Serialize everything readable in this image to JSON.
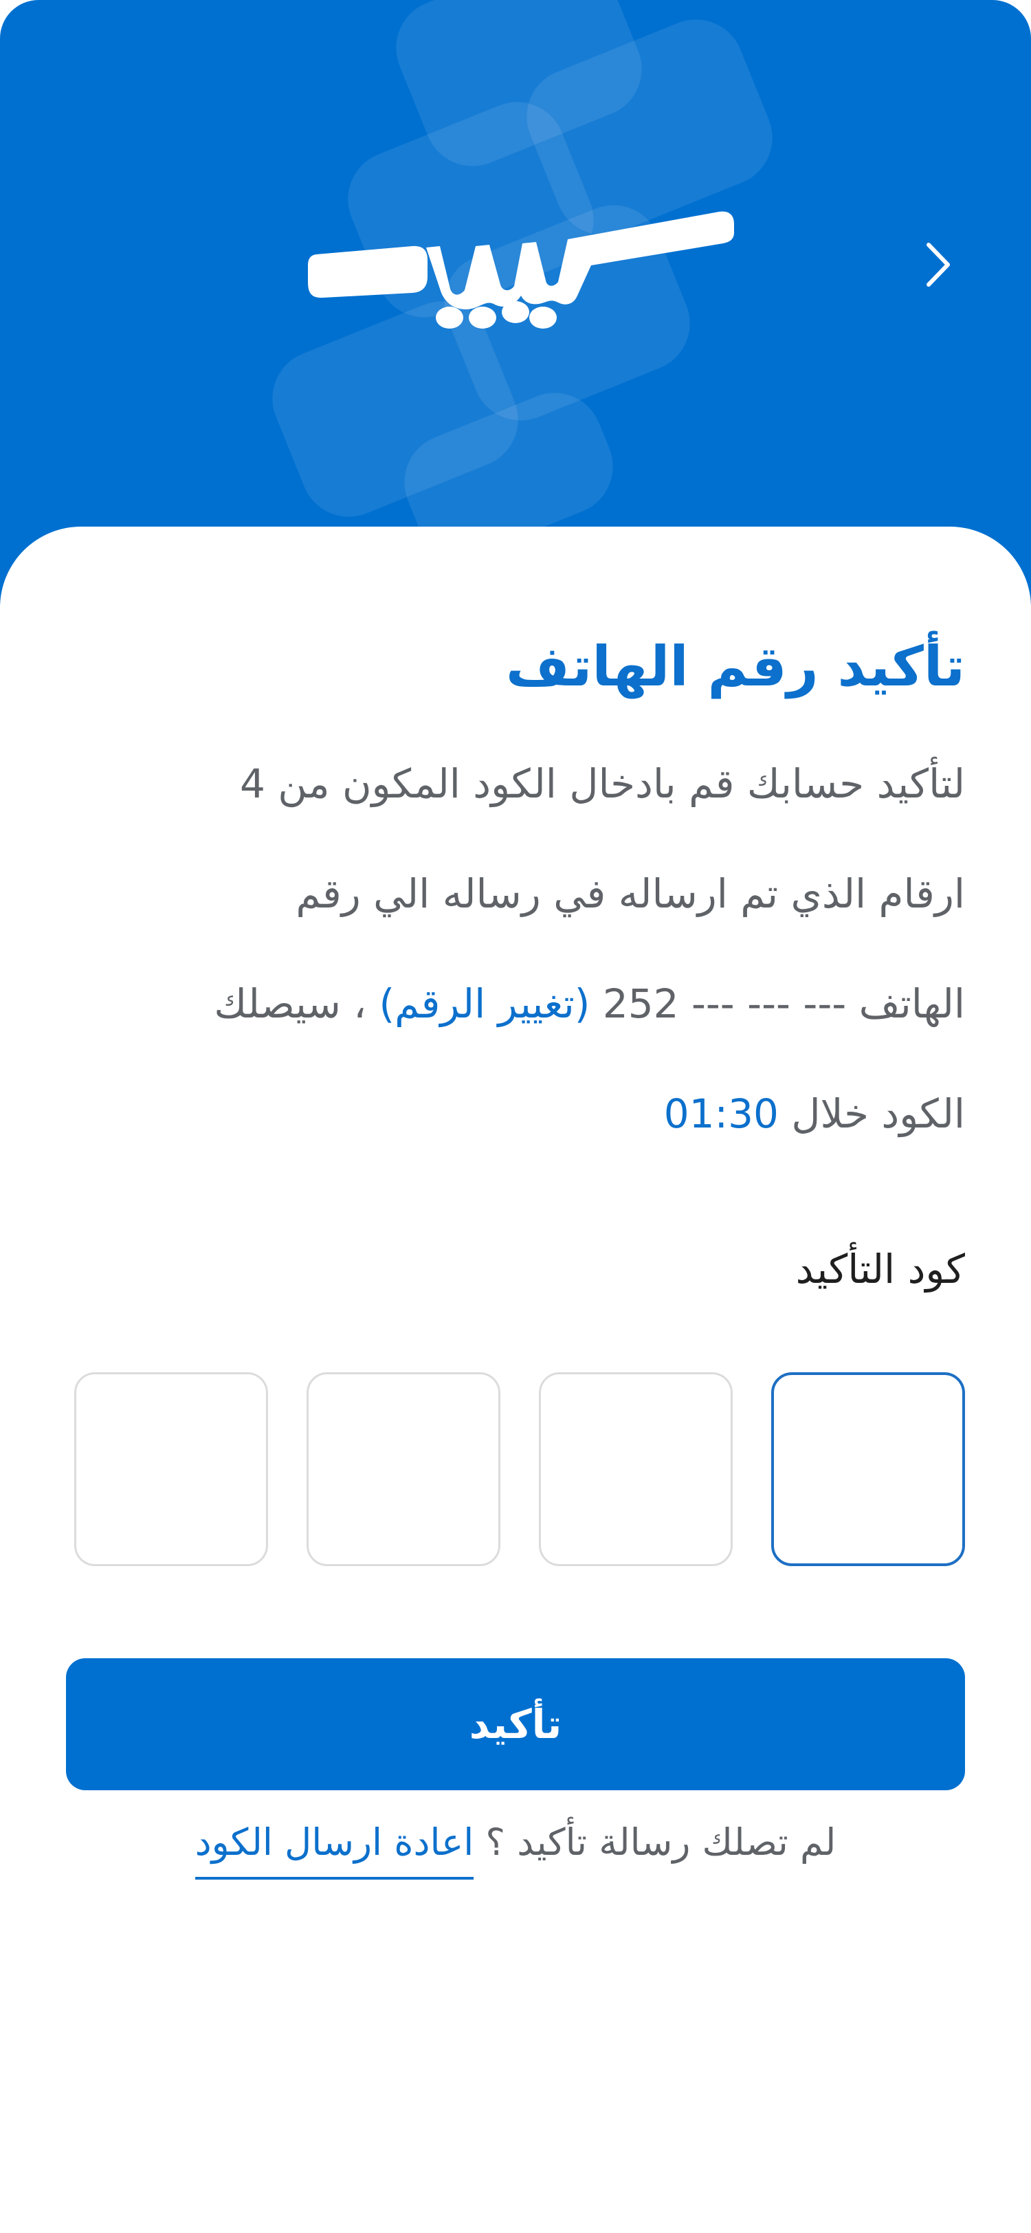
{
  "header": {
    "logo_text": "سيير",
    "back_icon": "chevron-right-icon",
    "background_color": "#0070D0"
  },
  "page": {
    "title": "تأكيد رقم الهاتف",
    "description": {
      "line1": "لتأكيد حسابك قم بادخال الكود المكون من 4",
      "line2": "ارقام الذي تم ارساله في رساله الي رقم",
      "line3_prefix": "الهاتف",
      "phone_masked": "252 --- --- ---",
      "change_number_link": "(تغيير الرقم)",
      "line3_suffix": "، سيصلك",
      "line4_prefix": "الكود خلال",
      "timer": "01:30"
    },
    "code_label": "كود التأكيد",
    "otp": {
      "digits": [
        "",
        "",
        "",
        ""
      ],
      "active_index": 0
    },
    "confirm_button": "تأكيد",
    "resend": {
      "prompt": "لم تصلك رسالة تأكيد ؟",
      "link": "اعادة ارسال الكود"
    }
  },
  "colors": {
    "primary": "#0070D0",
    "text_muted": "#5F6368",
    "text_dark": "#1F1F1F",
    "input_border": "#DCDCDC"
  }
}
